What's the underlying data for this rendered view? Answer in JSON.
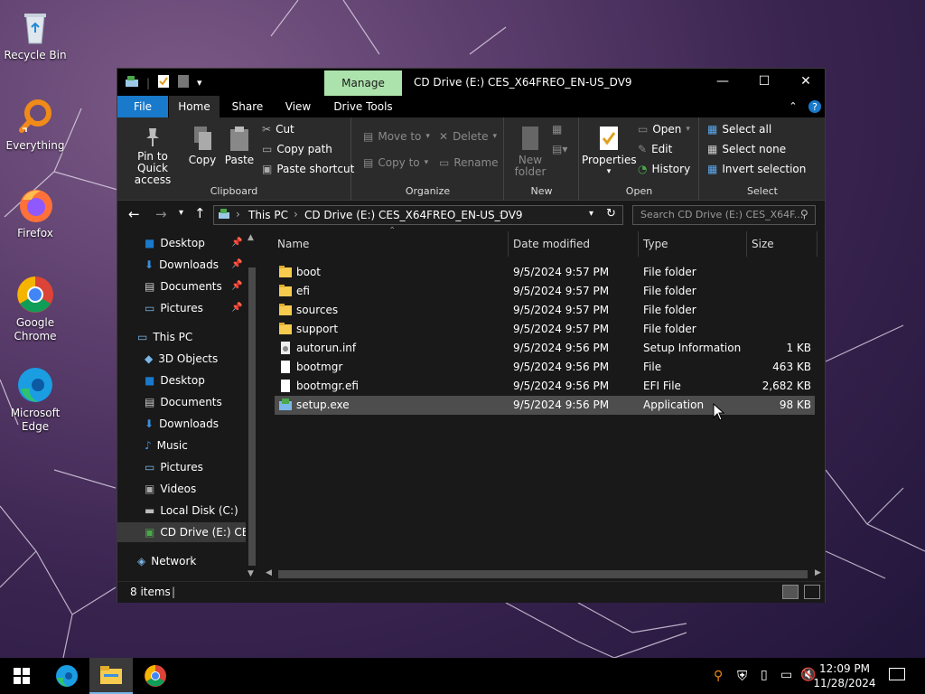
{
  "desktop": {
    "icons": [
      {
        "label": "Recycle Bin",
        "icon": "recycle-bin-icon"
      },
      {
        "label": "Everything",
        "icon": "everything-search-icon"
      },
      {
        "label": "Firefox",
        "icon": "firefox-icon"
      },
      {
        "label": "Google Chrome",
        "icon": "chrome-icon"
      },
      {
        "label": "Microsoft Edge",
        "icon": "edge-icon"
      }
    ]
  },
  "window": {
    "title": "CD Drive (E:) CES_X64FREO_EN-US_DV9",
    "manage_tab": "Manage",
    "tabs": [
      "File",
      "Home",
      "Share",
      "View",
      "Drive Tools"
    ],
    "controls": {
      "minimize": "—",
      "maximize": "☐",
      "close": "✕"
    }
  },
  "ribbon": {
    "clipboard": {
      "label": "Clipboard",
      "pin": "Pin to Quick access",
      "copy": "Copy",
      "paste": "Paste",
      "cut": "Cut",
      "copy_path": "Copy path",
      "paste_shortcut": "Paste shortcut"
    },
    "organize": {
      "label": "Organize",
      "move_to": "Move to",
      "copy_to": "Copy to",
      "delete": "Delete",
      "rename": "Rename"
    },
    "new": {
      "label": "New",
      "new_folder": "New folder"
    },
    "open": {
      "label": "Open",
      "properties": "Properties",
      "open": "Open",
      "edit": "Edit",
      "history": "History"
    },
    "select": {
      "label": "Select",
      "select_all": "Select all",
      "select_none": "Select none",
      "invert": "Invert selection"
    }
  },
  "address": {
    "crumbs": [
      "This PC",
      "CD Drive (E:) CES_X64FREO_EN-US_DV9"
    ],
    "search_placeholder": "Search CD Drive (E:) CES_X64F..."
  },
  "nav": {
    "quick": [
      "Desktop",
      "Downloads",
      "Documents",
      "Pictures"
    ],
    "this_pc": "This PC",
    "pc_items": [
      "3D Objects",
      "Desktop",
      "Documents",
      "Downloads",
      "Music",
      "Pictures",
      "Videos",
      "Local Disk (C:)",
      "CD Drive (E:) CES"
    ],
    "network": "Network"
  },
  "columns": {
    "name": "Name",
    "date": "Date modified",
    "type": "Type",
    "size": "Size"
  },
  "files": [
    {
      "name": "boot",
      "date": "9/5/2024 9:57 PM",
      "type": "File folder",
      "size": "",
      "kind": "folder"
    },
    {
      "name": "efi",
      "date": "9/5/2024 9:57 PM",
      "type": "File folder",
      "size": "",
      "kind": "folder"
    },
    {
      "name": "sources",
      "date": "9/5/2024 9:57 PM",
      "type": "File folder",
      "size": "",
      "kind": "folder"
    },
    {
      "name": "support",
      "date": "9/5/2024 9:57 PM",
      "type": "File folder",
      "size": "",
      "kind": "folder"
    },
    {
      "name": "autorun.inf",
      "date": "9/5/2024 9:56 PM",
      "type": "Setup Information",
      "size": "1 KB",
      "kind": "inf"
    },
    {
      "name": "bootmgr",
      "date": "9/5/2024 9:56 PM",
      "type": "File",
      "size": "463 KB",
      "kind": "file"
    },
    {
      "name": "bootmgr.efi",
      "date": "9/5/2024 9:56 PM",
      "type": "EFI File",
      "size": "2,682 KB",
      "kind": "file"
    },
    {
      "name": "setup.exe",
      "date": "9/5/2024 9:56 PM",
      "type": "Application",
      "size": "98 KB",
      "kind": "exe"
    }
  ],
  "status": {
    "items": "8 items"
  },
  "taskbar": {
    "time": "12:09 PM",
    "date": "11/28/2024",
    "apps": [
      "windows-start-icon",
      "edge-icon",
      "file-explorer-icon",
      "chrome-icon"
    ]
  },
  "colors": {
    "accent": "#1979ca",
    "manage": "#ace2ab",
    "folder": "#f7cb4d",
    "window_bg": "#191919",
    "ribbon_bg": "#2b2b2b",
    "selected_row": "#4d4d4d"
  }
}
